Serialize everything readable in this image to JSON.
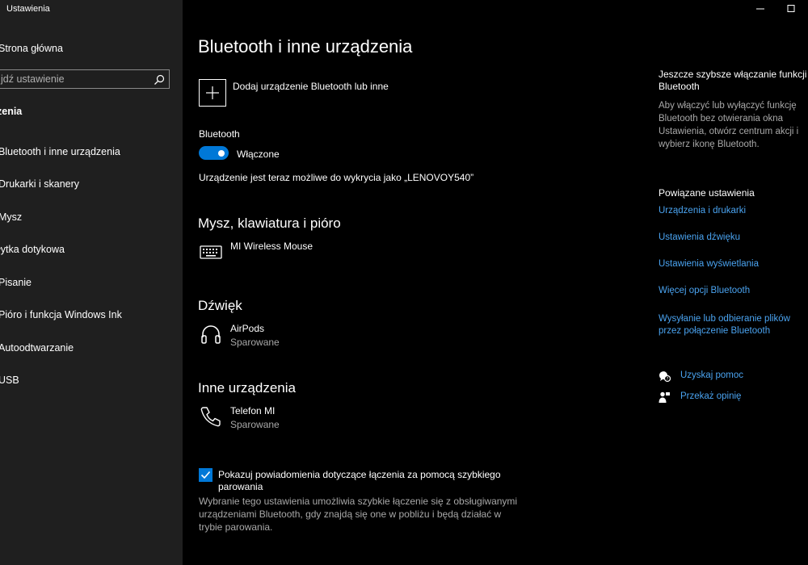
{
  "window": {
    "title": "Ustawienia"
  },
  "sidebar": {
    "home": "Strona główna",
    "search_placeholder": "jdź ustawienie",
    "section": "zenia",
    "items": [
      {
        "label": "Bluetooth i inne urządzenia"
      },
      {
        "label": "Drukarki i skanery"
      },
      {
        "label": "Mysz"
      },
      {
        "label": "łytka dotykowa"
      },
      {
        "label": "Pisanie"
      },
      {
        "label": "Pióro i funkcja Windows Ink"
      },
      {
        "label": "Autoodtwarzanie"
      },
      {
        "label": "USB"
      }
    ]
  },
  "main": {
    "title": "Bluetooth i inne urządzenia",
    "add_device": "Dodaj urządzenie Bluetooth lub inne",
    "bluetooth_label": "Bluetooth",
    "toggle_state": "Włączone",
    "discoverable": "Urządzenie jest teraz możliwe do wykrycia jako „LENOVOY540”",
    "sections": {
      "input": {
        "title": "Mysz, klawiatura i pióro",
        "device": "MI Wireless Mouse"
      },
      "audio": {
        "title": "Dźwięk",
        "device": "AirPods",
        "status": "Sparowane"
      },
      "other": {
        "title": "Inne urządzenia",
        "device": "Telefon MI",
        "status": "Sparowane"
      }
    },
    "swift_pair": {
      "checked": true,
      "label": "Pokazuj powiadomienia dotyczące łączenia za pomocą szybkiego parowania",
      "description": "Wybranie tego ustawienia umożliwia szybkie łączenie się z obsługiwanymi urządzeniami Bluetooth, gdy znajdą się one w pobliżu i będą działać w trybie parowania."
    }
  },
  "right_panel": {
    "tip_title": "Jeszcze szybsze włączanie funkcji Bluetooth",
    "tip_text": "Aby włączyć lub wyłączyć funkcję Bluetooth bez otwierania okna Ustawienia, otwórz centrum akcji i wybierz ikonę Bluetooth.",
    "related_heading": "Powiązane ustawienia",
    "links": [
      "Urządzenia i drukarki",
      "Ustawienia dźwięku",
      "Ustawienia wyświetlania",
      "Więcej opcji Bluetooth",
      "Wysyłanie lub odbieranie plików przez połączenie Bluetooth"
    ],
    "help": "Uzyskaj pomoc",
    "feedback": "Przekaż opinię"
  },
  "colors": {
    "accent": "#0078d7",
    "link": "#4aa3f0",
    "sidebar_bg": "#1f1f1f",
    "bg": "#000000"
  }
}
